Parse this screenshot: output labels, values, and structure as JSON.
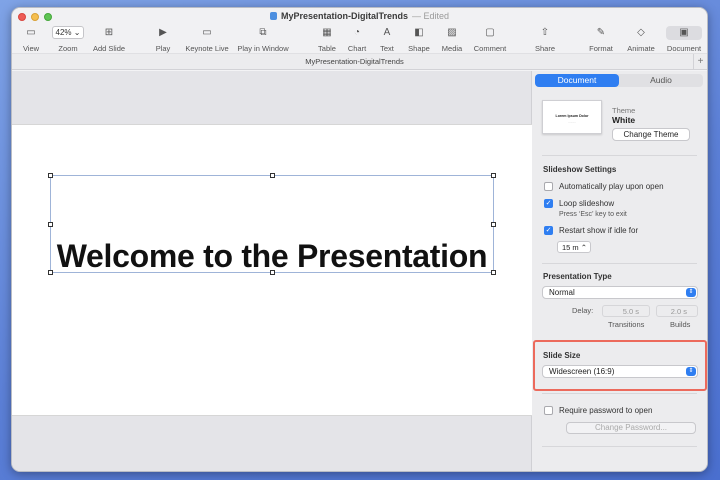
{
  "window": {
    "doc_title": "MyPresentation-DigitalTrends",
    "status": "Edited",
    "tab_name": "MyPresentation-DigitalTrends"
  },
  "toolbar": {
    "view": "View",
    "zoom_value": "42%",
    "zoom": "Zoom",
    "add_slide": "Add Slide",
    "play": "Play",
    "keynote_live": "Keynote Live",
    "play_in_window": "Play in Window",
    "table": "Table",
    "chart": "Chart",
    "text": "Text",
    "shape": "Shape",
    "media": "Media",
    "comment": "Comment",
    "share": "Share",
    "format": "Format",
    "animate": "Animate",
    "document": "Document"
  },
  "slide": {
    "title": "Welcome to the Presentation"
  },
  "sidebar": {
    "tabs": {
      "document": "Document",
      "audio": "Audio"
    },
    "theme": {
      "thumb_title": "Lorem Ipsum Dolor",
      "label": "Theme",
      "name": "White",
      "change_button": "Change Theme"
    },
    "slideshow": {
      "heading": "Slideshow Settings",
      "autoplay": "Automatically play upon open",
      "loop": "Loop slideshow",
      "loop_hint": "Press ‘Esc’ key to exit",
      "restart": "Restart show if idle for",
      "idle_value": "15 m"
    },
    "presentation_type": {
      "heading": "Presentation Type",
      "selected": "Normal",
      "delay_label": "Delay:",
      "transitions_value": "5.0 s",
      "builds_value": "2.0 s",
      "transitions_label": "Transitions",
      "builds_label": "Builds"
    },
    "slide_size": {
      "heading": "Slide Size",
      "selected": "Widescreen (16:9)"
    },
    "password": {
      "label": "Require password to open",
      "button": "Change Password..."
    }
  },
  "colors": {
    "accent": "#2f7ef1",
    "highlight": "#ec6a5c"
  }
}
